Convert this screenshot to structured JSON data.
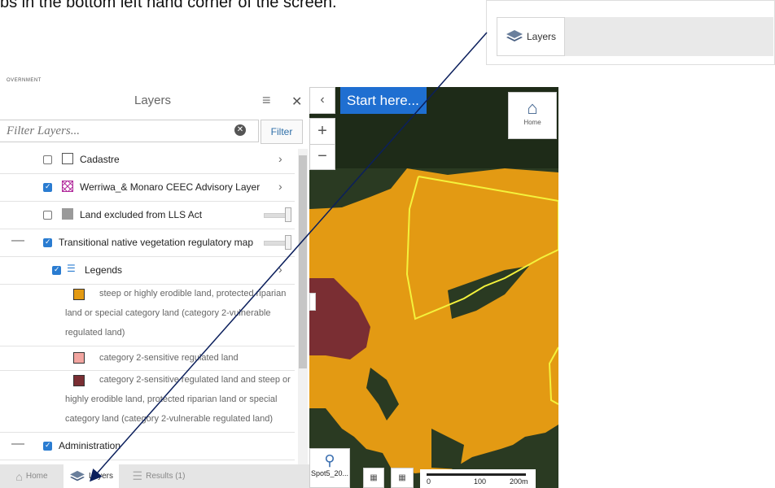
{
  "instruction": "bs in the bottom left hand corner of the screen.",
  "callout": {
    "tab_label": "Layers"
  },
  "gov_strip": "OVERNMENT",
  "panel": {
    "title": "Layers",
    "filter_placeholder": "Filter Layers...",
    "filter_button": "Filter"
  },
  "layers": {
    "cadastre": "Cadastre",
    "werriwa": "Werriwa_& Monaro CEEC Advisory Layer",
    "land_excluded": "Land excluded from LLS Act",
    "transitional": "Transitional native vegetation regulatory map",
    "legends": "Legends",
    "administration": "Administration"
  },
  "legend_items": [
    {
      "text": "steep or highly erodible land, protected riparian land or special category land (category 2-vulnerable regulated land)",
      "color": "#e39a13"
    },
    {
      "text": "category 2-sensitive regulated land",
      "color": "#f2a5a0"
    },
    {
      "text": "category 2-sensitive regulated land and steep or highly erodible land, protected riparian land or special category land (category 2-vulnerable regulated land)",
      "color": "#7a2e33"
    }
  ],
  "bottom_tabs": {
    "home": "Home",
    "layers": "Layers",
    "results": "Results (1)"
  },
  "map": {
    "start_here": "Start here...",
    "home_label": "Home",
    "spot_label": "Spot5_20...",
    "scale_labels": [
      "0",
      "100",
      "200m"
    ]
  }
}
